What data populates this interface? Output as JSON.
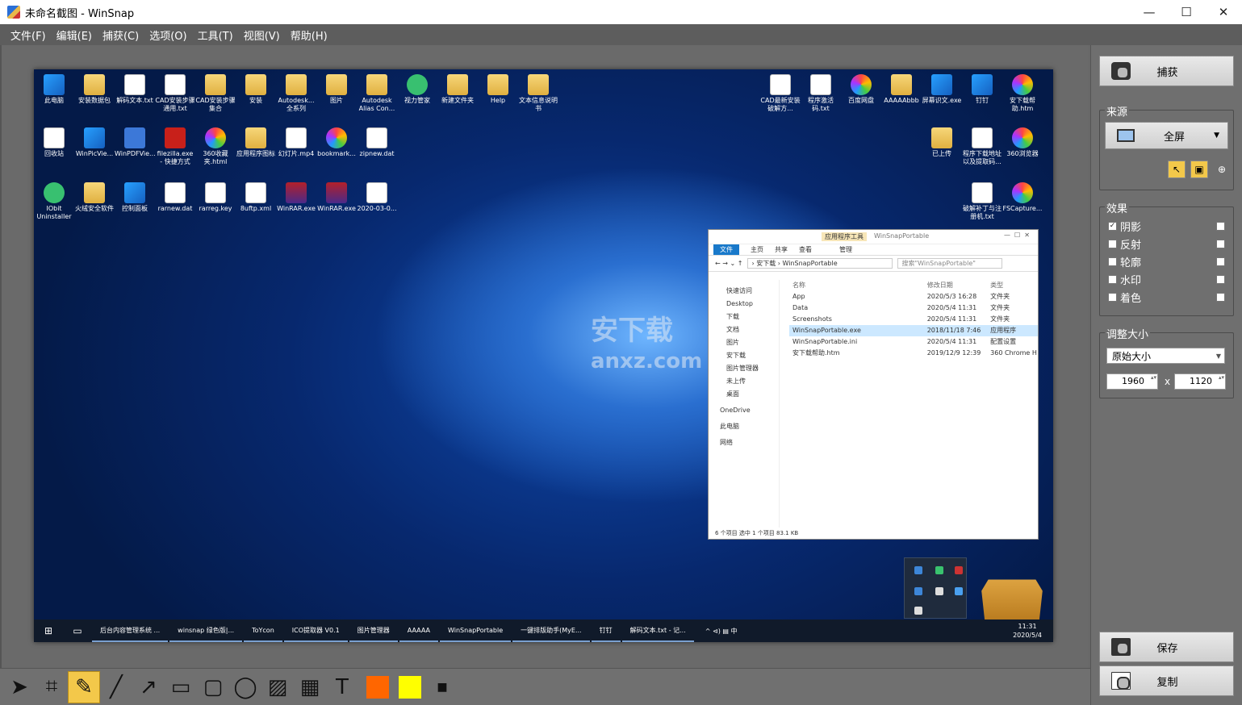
{
  "window": {
    "title": "未命名截图 - WinSnap",
    "minimize": "—",
    "maximize": "☐",
    "close": "✕"
  },
  "menu": [
    "文件(F)",
    "编辑(E)",
    "捕获(C)",
    "选项(O)",
    "工具(T)",
    "视图(V)",
    "帮助(H)"
  ],
  "side": {
    "capture_label": "捕获",
    "source_title": "来源",
    "source_value": "全屏",
    "effects_title": "效果",
    "effects": [
      {
        "label": "阴影",
        "checked": true
      },
      {
        "label": "反射",
        "checked": false
      },
      {
        "label": "轮廓",
        "checked": false
      },
      {
        "label": "水印",
        "checked": false
      },
      {
        "label": "着色",
        "checked": false
      }
    ],
    "resize_title": "调整大小",
    "resize_mode": "原始大小",
    "width": "1960",
    "x_sep": "x",
    "height": "1120",
    "save_label": "保存",
    "copy_label": "复制"
  },
  "toolbar": {
    "tools": [
      "pointer-tool",
      "crop-tool",
      "pen-tool",
      "line-tool",
      "arrow-tool",
      "rectangle-tool",
      "rounded-rect-tool",
      "ellipse-tool",
      "hatch-tool",
      "pixelate-tool",
      "text-tool"
    ],
    "primary_color": "#ff6600",
    "secondary_color": "#ffff00"
  },
  "desktop": {
    "icons_row1": [
      "此电脑",
      "安装数据包",
      "解码文本.txt",
      "CAD安装步骤通用.txt",
      "CAD安装步骤集合",
      "安装",
      "Autodesk...全系列",
      "图片",
      "Autodesk Alias Con...",
      "视力管家",
      "新建文件夹",
      "Help",
      "文本信息说明书"
    ],
    "icons_row2": [
      "回收站",
      "WinPicVie...",
      "WinPDFVie...",
      "filezilla.exe - 快捷方式",
      "360收藏夹.html",
      "应用程序图标",
      "幻灯片.mp4",
      "bookmark...",
      "zipnew.dat"
    ],
    "icons_row3": [
      "IObit Uninstaller",
      "火绒安全软件",
      "控制面板",
      "rarnew.dat",
      "rarreg.key",
      "8uftp.xml",
      "WinRAR.exe",
      "WinRAR.exe",
      "2020-03-0..."
    ],
    "icons_right1": [
      "CAD最新安装破解方...",
      "程序激活码.txt",
      "百度网盘",
      "AAAAAbbb",
      "屏幕识文.exe",
      "钉钉",
      "安下载帮助.htm"
    ],
    "icons_right2": [
      "已上传",
      "程序下载地址以及提取码...",
      "360浏览器"
    ],
    "icons_right3": [
      "破解补丁与注册机.txt",
      "FSCapture..."
    ]
  },
  "explorer": {
    "title": "WinSnapPortable",
    "context_tab": "应用程序工具",
    "ribbon": [
      "文件",
      "主页",
      "共享",
      "查看",
      "管理"
    ],
    "path_a": "安下载",
    "path_b": "WinSnapPortable",
    "search": "搜索\"WinSnapPortable\"",
    "nav": [
      "快速访问",
      "Desktop",
      "下载",
      "文档",
      "图片",
      "安下载",
      "图片管理器",
      "未上传",
      "桌面",
      "OneDrive",
      "此电脑",
      "网络"
    ],
    "columns": {
      "name": "名称",
      "date": "修改日期",
      "type": "类型"
    },
    "files": [
      {
        "name": "App",
        "date": "2020/5/3 16:28",
        "type": "文件夹"
      },
      {
        "name": "Data",
        "date": "2020/5/4 11:31",
        "type": "文件夹"
      },
      {
        "name": "Screenshots",
        "date": "2020/5/4 11:31",
        "type": "文件夹"
      },
      {
        "name": "WinSnapPortable.exe",
        "date": "2018/11/18 7:46",
        "type": "应用程序"
      },
      {
        "name": "WinSnapPortable.ini",
        "date": "2020/5/4 11:31",
        "type": "配置设置"
      },
      {
        "name": "安下载帮助.htm",
        "date": "2019/12/9 12:39",
        "type": "360 Chrome H"
      }
    ],
    "status": "6 个项目    选中 1 个项目  83.1 KB"
  },
  "watermark": {
    "line1": "安下载",
    "line2": "anxz.com"
  },
  "taskbar": {
    "items": [
      "后台内容管理系统 ...",
      "winsnap 绿色版|...",
      "ToYcon",
      "ICO提取器 V0.1",
      "图片管理器",
      "AAAAA",
      "WinSnapPortable",
      "一键排版助手(MyE...",
      "钉钉",
      "解码文本.txt - 记..."
    ],
    "time": "11:31",
    "date": "2020/5/4",
    "tray": "^ ⊲) ▤ 中"
  }
}
